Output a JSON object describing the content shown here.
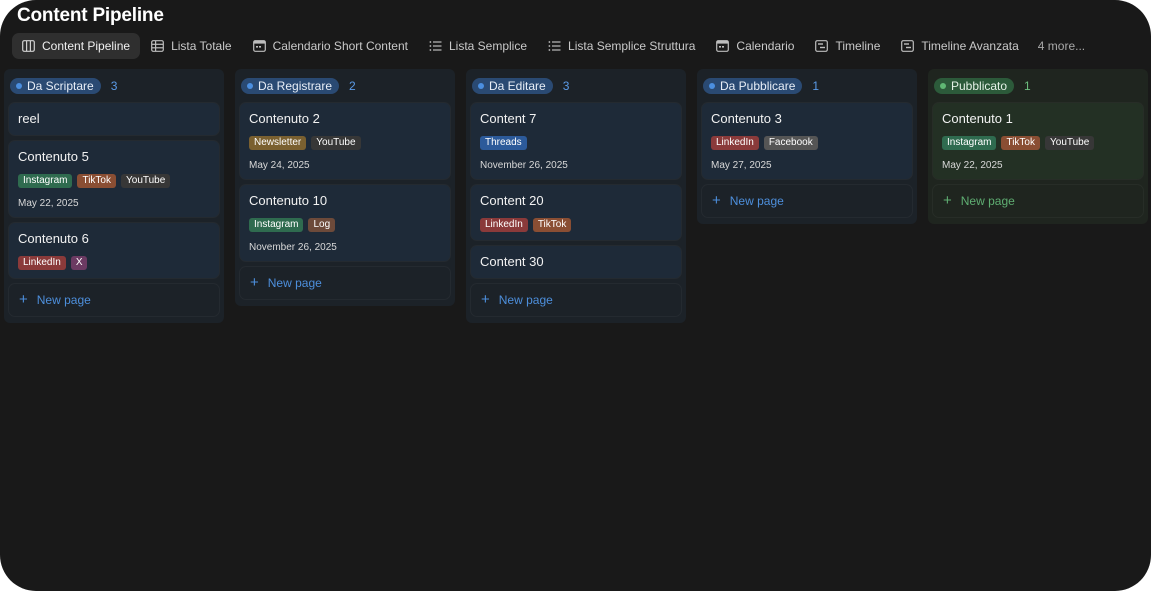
{
  "page": {
    "title": "Content Pipeline"
  },
  "tabs": [
    {
      "label": "Content Pipeline",
      "icon": "board-icon",
      "active": true
    },
    {
      "label": "Lista Totale",
      "icon": "table-icon"
    },
    {
      "label": "Calendario Short Content",
      "icon": "calendar-icon"
    },
    {
      "label": "Lista Semplice",
      "icon": "list-icon"
    },
    {
      "label": "Lista Semplice Struttura",
      "icon": "list-icon"
    },
    {
      "label": "Calendario",
      "icon": "calendar-icon"
    },
    {
      "label": "Timeline",
      "icon": "timeline-icon"
    },
    {
      "label": "Timeline Avanzata",
      "icon": "timeline-icon"
    }
  ],
  "more_label": "4 more...",
  "new_page_label": "New page",
  "colors": {
    "Instagram": "#2f6b4f",
    "TikTok": "#8a4e33",
    "YouTube": "#373737",
    "LinkedIn": "#8a3a3a",
    "X": "#6b3a62",
    "Newsletter": "#7a6030",
    "Log": "#6d4a3a",
    "Threads": "#2c5a9a",
    "Facebook": "#555555"
  },
  "columns": [
    {
      "status": "Da Scriptare",
      "count": "3",
      "theme": "blue",
      "cards": [
        {
          "title": "reel",
          "tags": [],
          "date": ""
        },
        {
          "title": "Contenuto 5",
          "tags": [
            "Instagram",
            "TikTok",
            "YouTube"
          ],
          "date": "May 22, 2025"
        },
        {
          "title": "Contenuto 6",
          "tags": [
            "LinkedIn",
            "X"
          ],
          "date": ""
        }
      ]
    },
    {
      "status": "Da Registrare",
      "count": "2",
      "theme": "blue",
      "cards": [
        {
          "title": "Contenuto 2",
          "tags": [
            "Newsletter",
            "YouTube"
          ],
          "date": "May 24, 2025"
        },
        {
          "title": "Contenuto 10",
          "tags": [
            "Instagram",
            "Log"
          ],
          "date": "November 26, 2025"
        }
      ]
    },
    {
      "status": "Da Editare",
      "count": "3",
      "theme": "blue",
      "cards": [
        {
          "title": "Content 7",
          "tags": [
            "Threads"
          ],
          "date": "November 26, 2025"
        },
        {
          "title": "Content 20",
          "tags": [
            "LinkedIn",
            "TikTok"
          ],
          "date": ""
        },
        {
          "title": "Content 30",
          "tags": [],
          "date": ""
        }
      ]
    },
    {
      "status": "Da Pubblicare",
      "count": "1",
      "theme": "blue",
      "cards": [
        {
          "title": "Contenuto 3",
          "tags": [
            "LinkedIn",
            "Facebook"
          ],
          "date": "May 27, 2025"
        }
      ]
    },
    {
      "status": "Pubblicato",
      "count": "1",
      "theme": "green",
      "cards": [
        {
          "title": "Contenuto 1",
          "tags": [
            "Instagram",
            "TikTok",
            "YouTube"
          ],
          "date": "May 22, 2025"
        }
      ]
    }
  ]
}
